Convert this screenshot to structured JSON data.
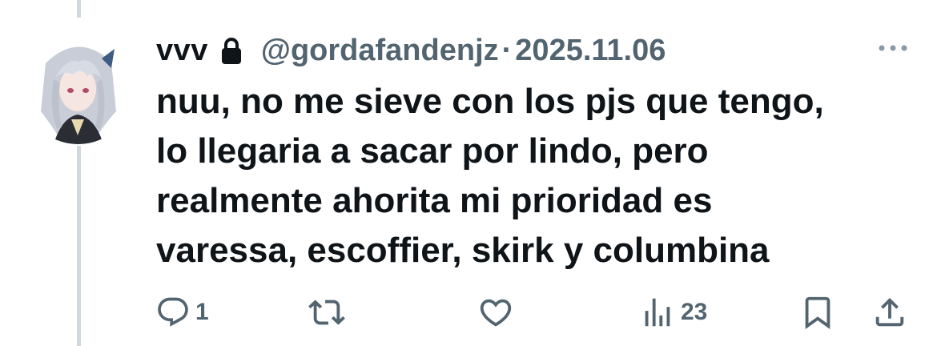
{
  "tweet": {
    "display_name": "vvv",
    "handle": "@gordafandenjz",
    "separator": "·",
    "date": "2025.11.06",
    "text_lines": [
      "nuu, no me sieve con los pjs que tengo,",
      "lo llegaria a sacar por lindo, pero",
      "realmente ahorita mi prioridad es",
      "varessa, escoffier, skirk y columbina"
    ],
    "protected_icon": "lock-icon",
    "more_icon": "more-horizontal-icon"
  },
  "actions": {
    "reply": {
      "icon": "reply-icon",
      "count": "1"
    },
    "retweet": {
      "icon": "retweet-icon",
      "count": ""
    },
    "like": {
      "icon": "heart-icon",
      "count": ""
    },
    "views": {
      "icon": "views-icon",
      "count": "23"
    },
    "bookmark": {
      "icon": "bookmark-icon"
    },
    "share": {
      "icon": "share-icon"
    }
  },
  "colors": {
    "text_primary": "#0f1419",
    "text_secondary": "#536471",
    "thread_line": "#cfd9de"
  }
}
